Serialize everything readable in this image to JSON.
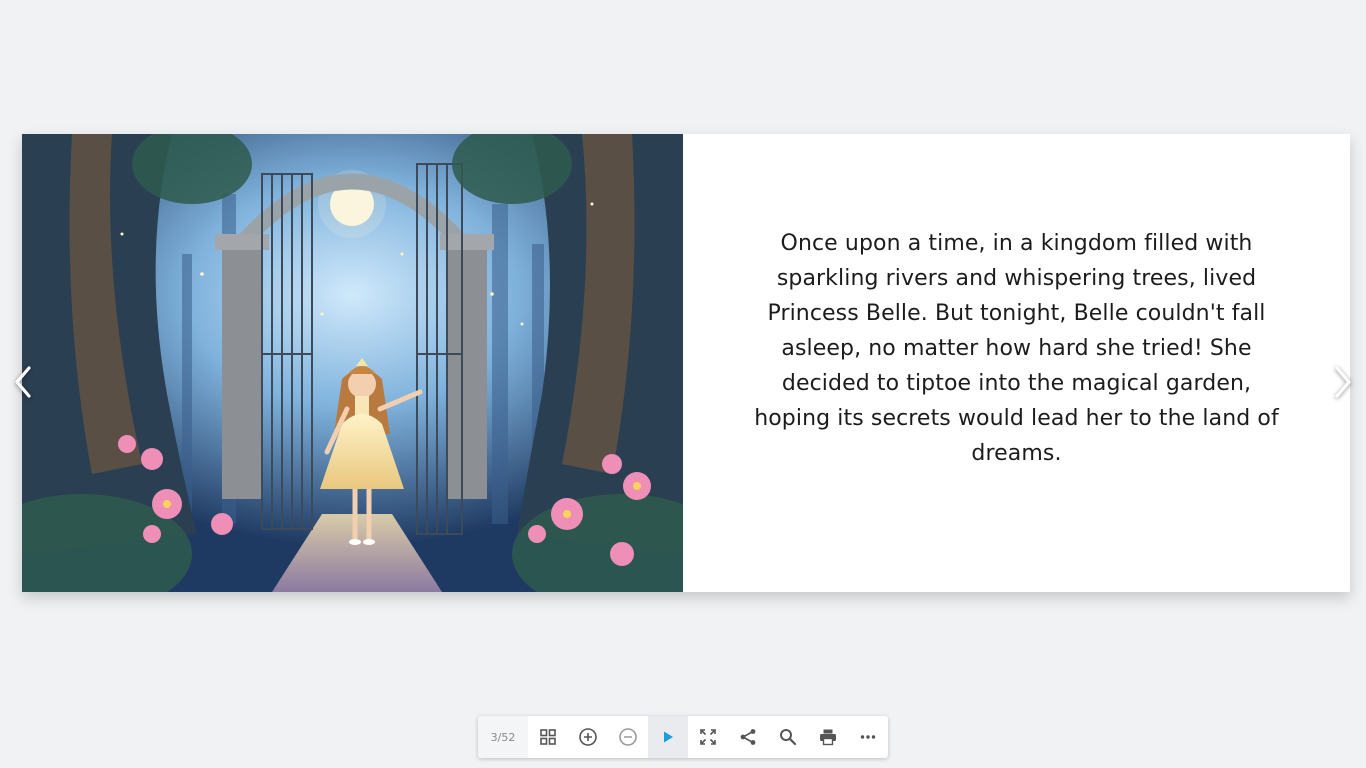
{
  "book": {
    "left_page": {
      "illustration": "princess-at-garden-gate-illustration"
    },
    "right_page": {
      "text": "Once upon a time, in a kingdom filled with sparkling rivers and whispering trees, lived Princess Belle. But tonight, Belle couldn't fall asleep, no matter how hard she tried! She decided to tiptoe into the magical garden, hoping its secrets would lead her to the land of dreams."
    }
  },
  "navigation": {
    "prev_icon": "chevron-left-icon",
    "next_icon": "chevron-right-icon"
  },
  "toolbar": {
    "page_counter": "3/52",
    "buttons": [
      {
        "icon": "grid-icon"
      },
      {
        "icon": "zoom-in-icon"
      },
      {
        "icon": "zoom-out-icon"
      },
      {
        "icon": "play-icon",
        "active": true
      },
      {
        "icon": "fullscreen-icon"
      },
      {
        "icon": "share-icon"
      },
      {
        "icon": "search-icon"
      },
      {
        "icon": "print-icon"
      },
      {
        "icon": "more-icon"
      }
    ]
  },
  "colors": {
    "background": "#f1f2f4",
    "play_accent": "#1a9fd8",
    "icon": "#555555",
    "text": "#1c1c1c"
  }
}
